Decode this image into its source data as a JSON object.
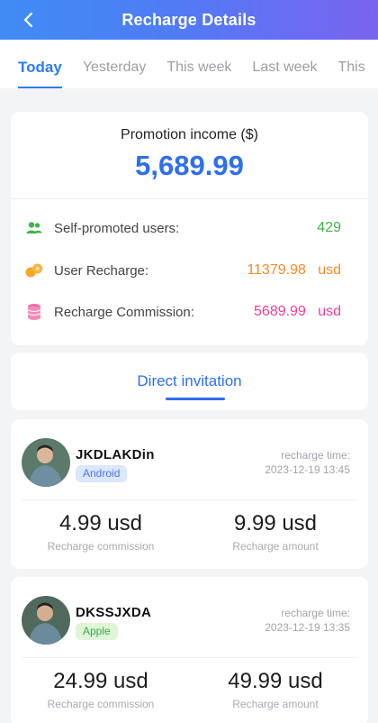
{
  "header": {
    "title": "Recharge Details"
  },
  "tabs": [
    {
      "label": "Today",
      "active": true
    },
    {
      "label": "Yesterday",
      "active": false
    },
    {
      "label": "This week",
      "active": false
    },
    {
      "label": "Last week",
      "active": false
    },
    {
      "label": "This",
      "active": false
    }
  ],
  "summary": {
    "label": "Promotion income ($)",
    "amount": "5,689.99",
    "rows": [
      {
        "label": "Self-promoted users:",
        "value": "429",
        "unit": "",
        "color": "#3bb549",
        "icon": "users-icon"
      },
      {
        "label": "User Recharge:",
        "value": "11379.98",
        "unit": "usd",
        "color": "#f58a25",
        "icon": "coins-icon"
      },
      {
        "label": "Recharge Commission:",
        "value": "5689.99",
        "unit": "usd",
        "color": "#ee3e9a",
        "icon": "stack-icon"
      }
    ]
  },
  "invite_tab": {
    "label": "Direct invitation"
  },
  "records": [
    {
      "name": "JKDLAKDin",
      "platform": "Android",
      "time_label": "recharge time:",
      "time": "2023-12-19  13:45",
      "commission": "4.99 usd",
      "commission_label": "Recharge commission",
      "amount": "9.99 usd",
      "amount_label": "Recharge amount"
    },
    {
      "name": "DKSSJXDA",
      "platform": "Apple",
      "time_label": "recharge time:",
      "time": "2023-12-19  13:35",
      "commission": "24.99 usd",
      "commission_label": "Recharge commission",
      "amount": "49.99 usd",
      "amount_label": "Recharge amount"
    }
  ]
}
